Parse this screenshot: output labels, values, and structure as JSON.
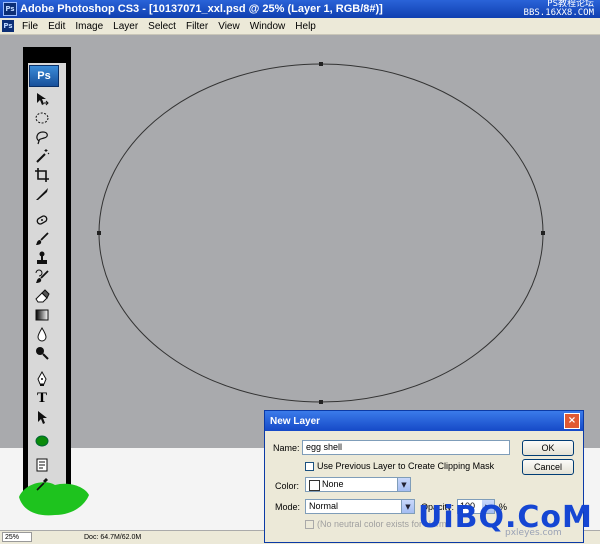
{
  "window": {
    "title": "Adobe Photoshop CS3 - [10137071_xxl.psd @ 25% (Layer 1, RGB/8#)]",
    "app_icon": "Ps",
    "watermark_line1": "PS教程论坛",
    "watermark_line2": "BBS.16XX8.COM"
  },
  "menu": [
    "File",
    "Edit",
    "Image",
    "Layer",
    "Select",
    "Filter",
    "View",
    "Window",
    "Help"
  ],
  "toolbox": {
    "logo": "Ps",
    "tools": [
      "move-tool",
      "elliptical-marquee-tool",
      "lasso-tool",
      "magic-wand-tool",
      "crop-tool",
      "slice-tool",
      "healing-brush-tool",
      "brush-tool",
      "clone-stamp-tool",
      "history-brush-tool",
      "eraser-tool",
      "gradient-tool",
      "blur-tool",
      "dodge-tool",
      "pen-tool",
      "type-tool",
      "path-selection-tool",
      "ellipse-shape-tool",
      "notes-tool",
      "eyedropper-tool"
    ],
    "type_glyph": "T",
    "highlight_color": "#1ec31e"
  },
  "canvas": {
    "background": "#a9aaad",
    "path_color": "#333333"
  },
  "status": {
    "zoom": "25%",
    "doc": "Doc: 64.7M/62.0M"
  },
  "dialog": {
    "title": "New Layer",
    "name_label": "Name:",
    "name_value": "egg shell",
    "clip_label": "Use Previous Layer to Create Clipping Mask",
    "color_label": "Color:",
    "color_value": "None",
    "mode_label": "Mode:",
    "mode_value": "Normal",
    "opacity_label": "Opacity:",
    "opacity_value": "100",
    "opacity_unit": "%",
    "neutral_label": "(No neutral color exists for Normal mode.)",
    "ok_label": "OK",
    "cancel_label": "Cancel",
    "close_glyph": "×"
  },
  "watermark_bottom": "UiBQ.CoM",
  "watermark_small": "pxleyes.com"
}
